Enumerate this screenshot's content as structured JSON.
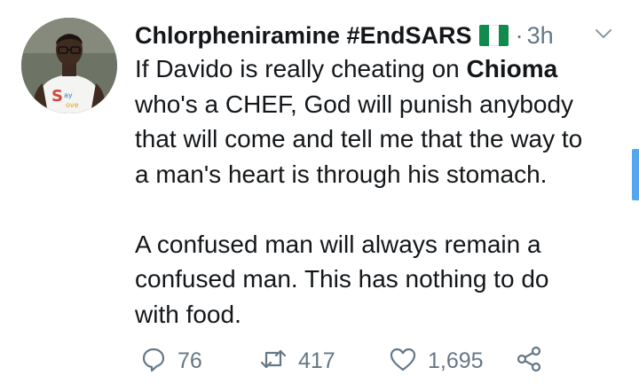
{
  "tweet": {
    "display_name": "Chlorpheniramine #EndSARS",
    "flag_icon": "nigeria-flag-icon",
    "separator": "·",
    "timestamp": "3h",
    "avatar_text": "Say WITH LOVE",
    "body": {
      "line1_pre": "If Davido is really cheating on ",
      "line1_bold": "Chioma",
      "line2": "who's a CHEF, God will punish anybody",
      "line3": "that will come and tell me that the way to",
      "line4": "a man's heart is through his stomach.",
      "line5": "A confused man will always remain a",
      "line6": "confused man. This has nothing to do",
      "line7": "with food."
    },
    "actions": {
      "reply_count": "76",
      "retweet_count": "417",
      "like_count": "1,695"
    }
  },
  "colors": {
    "text": "#14171a",
    "secondary": "#657786",
    "accent": "#54a6ee",
    "flag_green": "#118a4d"
  },
  "icons": [
    "chevron-down-icon",
    "reply-icon",
    "retweet-icon",
    "like-icon",
    "share-icon"
  ]
}
